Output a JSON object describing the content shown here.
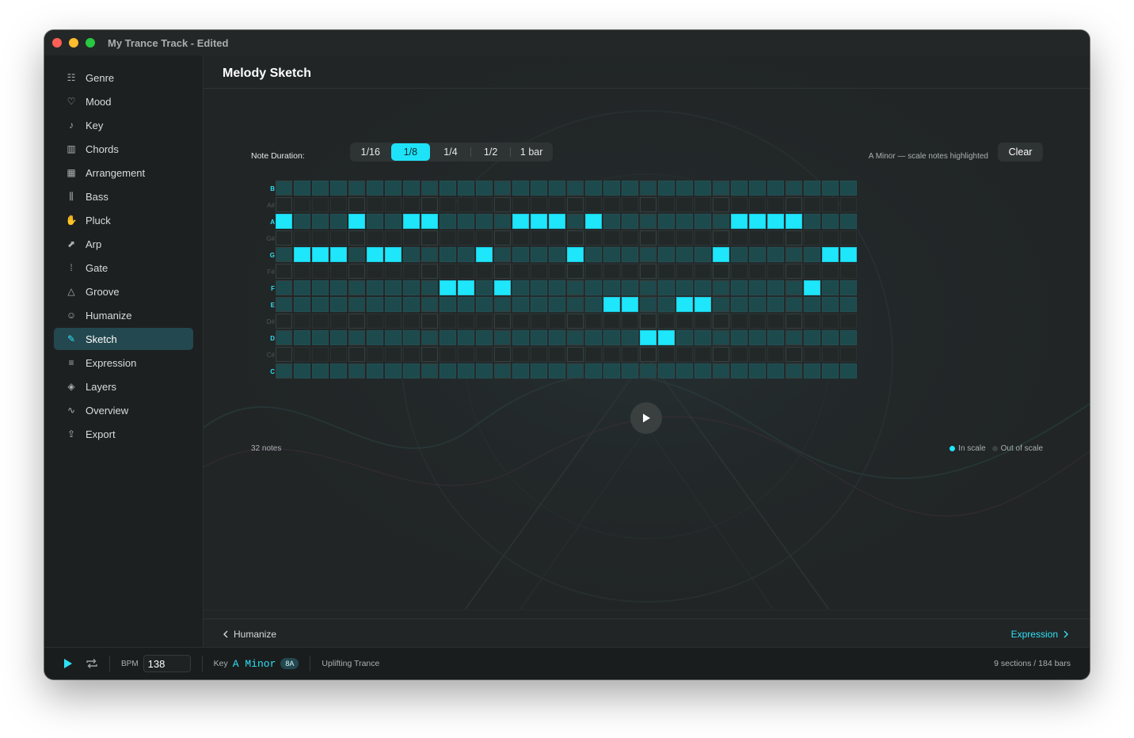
{
  "window": {
    "title": "My Trance Track - Edited"
  },
  "sidebar": {
    "items": [
      {
        "label": "Genre",
        "icon": "genre-icon",
        "glyph": "☷"
      },
      {
        "label": "Mood",
        "icon": "mood-icon",
        "glyph": "♡"
      },
      {
        "label": "Key",
        "icon": "music-note-icon",
        "glyph": "♪"
      },
      {
        "label": "Chords",
        "icon": "piano-icon",
        "glyph": "▥"
      },
      {
        "label": "Arrangement",
        "icon": "grid-icon",
        "glyph": "▦"
      },
      {
        "label": "Bass",
        "icon": "waveform-icon",
        "glyph": "⫼"
      },
      {
        "label": "Pluck",
        "icon": "hand-icon",
        "glyph": "✋"
      },
      {
        "label": "Arp",
        "icon": "arp-icon",
        "glyph": "⬈"
      },
      {
        "label": "Gate",
        "icon": "gate-icon",
        "glyph": "⁞"
      },
      {
        "label": "Groove",
        "icon": "triangle-icon",
        "glyph": "△"
      },
      {
        "label": "Humanize",
        "icon": "person-icon",
        "glyph": "☺"
      },
      {
        "label": "Sketch",
        "icon": "pencil-icon",
        "glyph": "✎",
        "active": true
      },
      {
        "label": "Expression",
        "icon": "sliders-icon",
        "glyph": "≡"
      },
      {
        "label": "Layers",
        "icon": "layers-icon",
        "glyph": "◈"
      },
      {
        "label": "Overview",
        "icon": "pulse-icon",
        "glyph": "∿"
      },
      {
        "label": "Export",
        "icon": "share-icon",
        "glyph": "⇪"
      }
    ]
  },
  "main": {
    "title": "Melody Sketch",
    "note_duration_label": "Note Duration:",
    "durations": [
      "1/16",
      "1/8",
      "1/4",
      "1/2",
      "1 bar"
    ],
    "selected_duration": "1/8",
    "scale_note": "A Minor — scale notes highlighted",
    "clear_label": "Clear",
    "notes_count": "32 notes",
    "legend": {
      "in_scale": "In scale",
      "out_scale": "Out of scale"
    },
    "prev_label": "Humanize",
    "next_label": "Expression"
  },
  "grid": {
    "columns": 32,
    "rows": [
      {
        "label": "B",
        "in_scale": true,
        "on": []
      },
      {
        "label": "A#",
        "in_scale": false,
        "on": []
      },
      {
        "label": "A",
        "in_scale": true,
        "on": [
          0,
          4,
          7,
          8,
          13,
          14,
          15,
          17,
          25,
          26,
          27,
          28
        ]
      },
      {
        "label": "G#",
        "in_scale": false,
        "on": []
      },
      {
        "label": "G",
        "in_scale": true,
        "on": [
          1,
          2,
          3,
          5,
          6,
          11,
          16,
          24,
          30,
          31
        ]
      },
      {
        "label": "F#",
        "in_scale": false,
        "on": []
      },
      {
        "label": "F",
        "in_scale": true,
        "on": [
          9,
          10,
          12,
          29
        ]
      },
      {
        "label": "E",
        "in_scale": true,
        "on": [
          18,
          19,
          22,
          23
        ]
      },
      {
        "label": "D#",
        "in_scale": false,
        "on": []
      },
      {
        "label": "D",
        "in_scale": true,
        "on": [
          20,
          21
        ]
      },
      {
        "label": "C#",
        "in_scale": false,
        "on": []
      },
      {
        "label": "C",
        "in_scale": true,
        "on": []
      }
    ]
  },
  "statusbar": {
    "bpm_label": "BPM",
    "bpm": "138",
    "key_label": "Key",
    "key": "A Minor",
    "camelot": "8A",
    "genre": "Uplifting Trance",
    "summary": "9 sections / 184 bars"
  },
  "colors": {
    "accent": "#1ee6fb",
    "in_scale_cell": "#1d4a4d",
    "out_scale_cell": "#222828",
    "sidebar_active": "#24484f"
  }
}
